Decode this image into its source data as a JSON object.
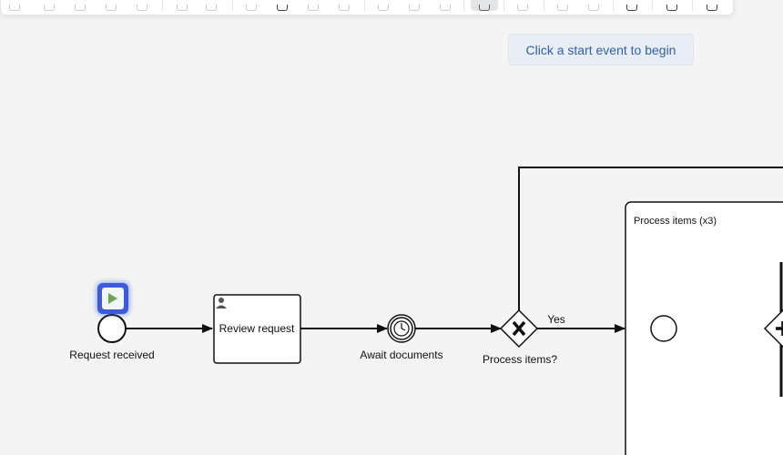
{
  "hint": {
    "text": "Click a start event to begin"
  },
  "diagram": {
    "start_event": {
      "label": "Request received"
    },
    "task": {
      "label": "Review request"
    },
    "timer_event": {
      "label": "Await documents"
    },
    "gateway": {
      "label": "Process items?",
      "yes_label": "Yes"
    },
    "subprocess": {
      "title": "Process items (x3)"
    }
  },
  "colors": {
    "canvas": "#f3f4f3",
    "hint_text": "#2f5fb3",
    "highlight": "#3b5bdb",
    "play": "#6aa84f"
  },
  "toolbar": {
    "icons": [
      "lasso-icon",
      "space-icon",
      "global-connect-icon",
      "hand-icon",
      "create-icon",
      "append-icon",
      "connect-icon",
      "task-icon",
      "user-task-icon",
      "service-task-icon",
      "script-task-icon",
      "gateway-icon",
      "event-icon",
      "subprocess-icon",
      "pool-icon",
      "lane-icon",
      "data-object-icon",
      "data-store-icon",
      "group-icon",
      "simulation-icon",
      "undo-icon",
      "redo-icon",
      "align-icon",
      "distribute-icon",
      "keyboard-icon"
    ]
  }
}
